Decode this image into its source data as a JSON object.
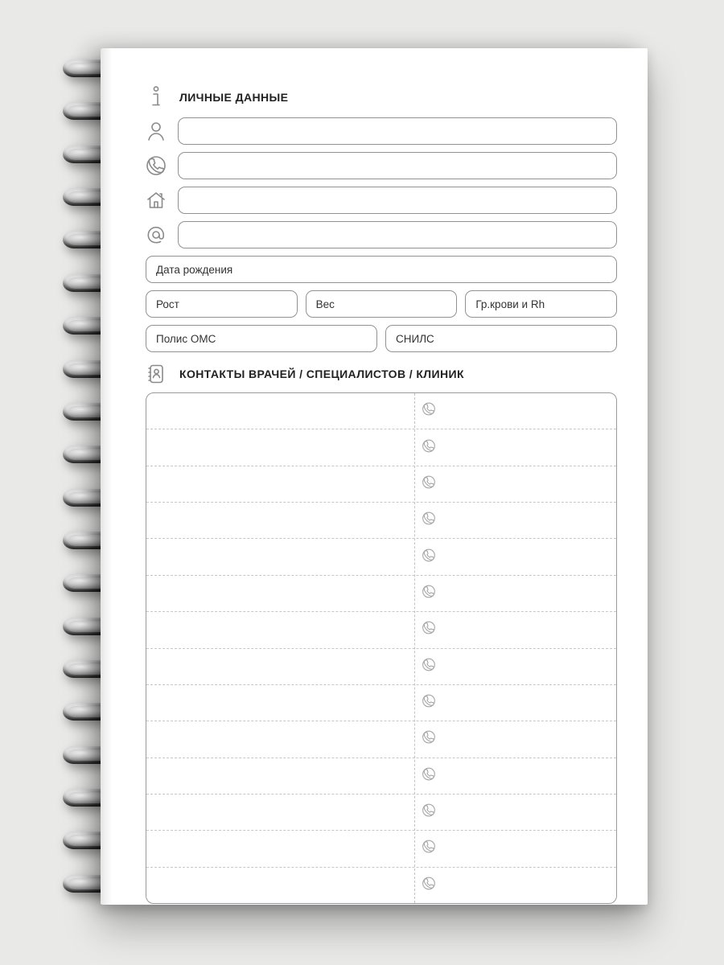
{
  "sections": {
    "personal": {
      "title": "ЛИЧНЫЕ ДАННЫЕ"
    },
    "contacts": {
      "title": "КОНТАКТЫ ВРАЧЕЙ / СПЕЦИАЛИСТОВ / КЛИНИК"
    }
  },
  "fields": {
    "name": {
      "value": ""
    },
    "phone": {
      "value": ""
    },
    "address": {
      "value": ""
    },
    "email": {
      "value": ""
    },
    "dob": {
      "label": "Дата рождения",
      "value": ""
    },
    "height": {
      "label": "Рост",
      "value": ""
    },
    "weight": {
      "label": "Вес",
      "value": ""
    },
    "blood": {
      "label": "Гр.крови и Rh",
      "value": ""
    },
    "oms": {
      "label": "Полис ОМС",
      "value": ""
    },
    "snils": {
      "label": "СНИЛС",
      "value": ""
    }
  },
  "contacts_rows": 14
}
